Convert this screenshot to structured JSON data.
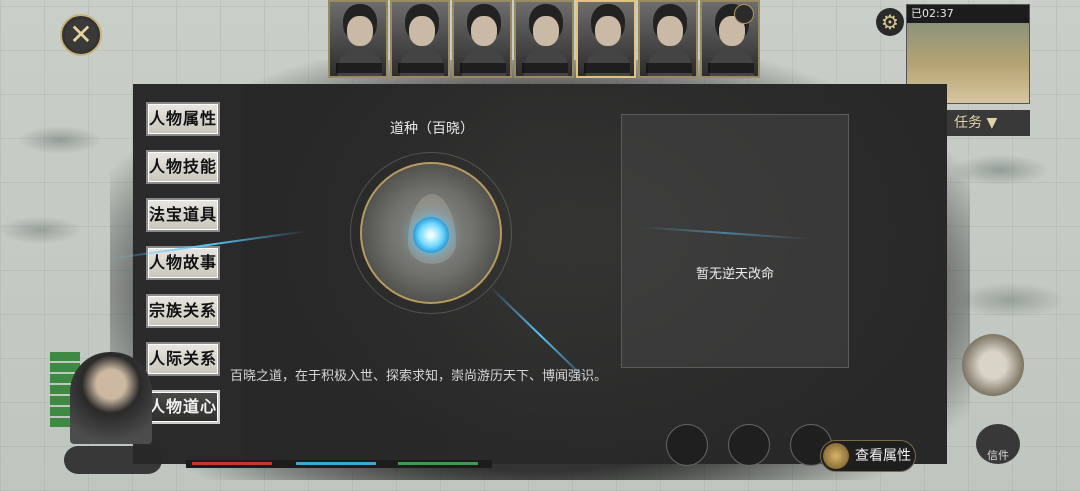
{
  "header": {
    "close_icon": "close-x-icon",
    "portraits": [
      {
        "active": false
      },
      {
        "active": false
      },
      {
        "active": false
      },
      {
        "active": true
      },
      {
        "active": false
      },
      {
        "active": false
      },
      {
        "active": false
      }
    ],
    "settings_icon": "gear-icon",
    "minimap_time": "已02:37"
  },
  "task_button": "任务 ▼",
  "side_menu": [
    {
      "label": "人物属性",
      "active": false
    },
    {
      "label": "人物技能",
      "active": false
    },
    {
      "label": "法宝道具",
      "active": false
    },
    {
      "label": "人物故事",
      "active": false
    },
    {
      "label": "宗族关系",
      "active": false
    },
    {
      "label": "人际关系",
      "active": false
    },
    {
      "label": "人物道心",
      "active": true
    }
  ],
  "dao": {
    "title": "道种（百晓）",
    "description": "百晓之道，在于积极入世、探索求知，崇尚游历天下、博闻强识。",
    "core_icon": "lotus-orb-icon"
  },
  "fate": {
    "empty_text": "暂无逆天改命"
  },
  "view_attributes_button": "查看属性",
  "bottom_bar_colors": {
    "red": "#c0392b",
    "blue": "#3aa7d6",
    "green": "#3f9a4a"
  },
  "right_bottom_icon": "letter-icon",
  "right_bottom_label": "信件"
}
